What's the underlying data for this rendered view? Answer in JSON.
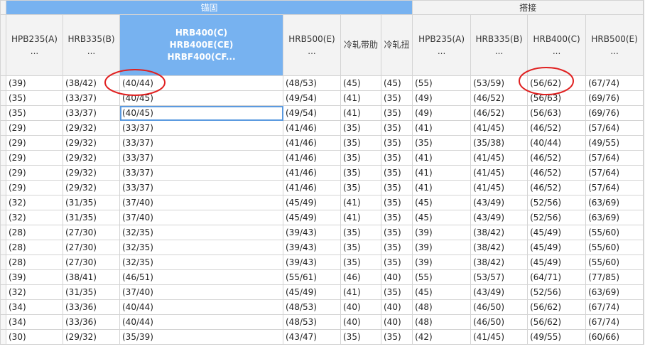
{
  "groups": {
    "anchor": "锚固",
    "lap": "搭接"
  },
  "headers": [
    [
      "HPB235(A)",
      "..."
    ],
    [
      "HRB335(B)",
      "..."
    ],
    [
      "HRB400(C)",
      "HRB400E(CE)",
      "HRBF400(CF..."
    ],
    [
      "HRB500(E)",
      "..."
    ],
    [
      "冷轧带肋"
    ],
    [
      "冷轧扭"
    ],
    [
      "HPB235(A)",
      "..."
    ],
    [
      "HRB335(B)",
      "..."
    ],
    [
      "HRB400(C)",
      "..."
    ],
    [
      "HRB500(E)",
      "..."
    ]
  ],
  "rows": [
    [
      "(39)",
      "(38/42)",
      "(40/44)",
      "(48/53)",
      "(45)",
      "(45)",
      "(55)",
      "(53/59)",
      "(56/62)",
      "(67/74)"
    ],
    [
      "(35)",
      "(33/37)",
      "(40/45)",
      "(49/54)",
      "(41)",
      "(35)",
      "(49)",
      "(46/52)",
      "(56/63)",
      "(69/76)"
    ],
    [
      "(35)",
      "(33/37)",
      "(40/45)",
      "(49/54)",
      "(41)",
      "(35)",
      "(49)",
      "(46/52)",
      "(56/63)",
      "(69/76)"
    ],
    [
      "(29)",
      "(29/32)",
      "(33/37)",
      "(41/46)",
      "(35)",
      "(35)",
      "(41)",
      "(41/45)",
      "(46/52)",
      "(57/64)"
    ],
    [
      "(29)",
      "(29/32)",
      "(33/37)",
      "(41/46)",
      "(35)",
      "(35)",
      "(35)",
      "(35/38)",
      "(40/44)",
      "(49/55)"
    ],
    [
      "(29)",
      "(29/32)",
      "(33/37)",
      "(41/46)",
      "(35)",
      "(35)",
      "(41)",
      "(41/45)",
      "(46/52)",
      "(57/64)"
    ],
    [
      "(29)",
      "(29/32)",
      "(33/37)",
      "(41/46)",
      "(35)",
      "(35)",
      "(41)",
      "(41/45)",
      "(46/52)",
      "(57/64)"
    ],
    [
      "(29)",
      "(29/32)",
      "(33/37)",
      "(41/46)",
      "(35)",
      "(35)",
      "(41)",
      "(41/45)",
      "(46/52)",
      "(57/64)"
    ],
    [
      "(32)",
      "(31/35)",
      "(37/40)",
      "(45/49)",
      "(41)",
      "(35)",
      "(45)",
      "(43/49)",
      "(52/56)",
      "(63/69)"
    ],
    [
      "(32)",
      "(31/35)",
      "(37/40)",
      "(45/49)",
      "(41)",
      "(35)",
      "(45)",
      "(43/49)",
      "(52/56)",
      "(63/69)"
    ],
    [
      "(28)",
      "(27/30)",
      "(32/35)",
      "(39/43)",
      "(35)",
      "(35)",
      "(39)",
      "(38/42)",
      "(45/49)",
      "(55/60)"
    ],
    [
      "(28)",
      "(27/30)",
      "(32/35)",
      "(39/43)",
      "(35)",
      "(35)",
      "(39)",
      "(38/42)",
      "(45/49)",
      "(55/60)"
    ],
    [
      "(28)",
      "(27/30)",
      "(32/35)",
      "(39/43)",
      "(35)",
      "(35)",
      "(39)",
      "(38/42)",
      "(45/49)",
      "(55/60)"
    ],
    [
      "(39)",
      "(38/41)",
      "(46/51)",
      "(55/61)",
      "(46)",
      "(40)",
      "(55)",
      "(53/57)",
      "(64/71)",
      "(77/85)"
    ],
    [
      "(32)",
      "(31/35)",
      "(37/40)",
      "(45/49)",
      "(41)",
      "(35)",
      "(45)",
      "(43/49)",
      "(52/56)",
      "(63/69)"
    ],
    [
      "(34)",
      "(33/36)",
      "(40/44)",
      "(48/53)",
      "(40)",
      "(40)",
      "(48)",
      "(46/50)",
      "(56/62)",
      "(67/74)"
    ],
    [
      "(34)",
      "(33/36)",
      "(40/44)",
      "(48/53)",
      "(40)",
      "(40)",
      "(48)",
      "(46/50)",
      "(56/62)",
      "(67/74)"
    ],
    [
      "(30)",
      "(29/32)",
      "(35/39)",
      "(43/47)",
      "(35)",
      "(35)",
      "(42)",
      "(41/45)",
      "(49/55)",
      "(60/66)"
    ]
  ],
  "selected_column_index": 2,
  "active_cell": {
    "row": 2,
    "col": 2
  },
  "colors": {
    "selected_header": "#77b2f0",
    "grid_line": "#d4d4d4",
    "annotation": "#e02020",
    "active_cell_border": "#5b9ae0"
  }
}
